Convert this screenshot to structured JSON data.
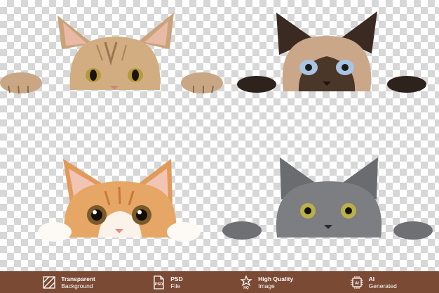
{
  "footer": {
    "background_color": "#7a4a34",
    "features": [
      {
        "icon": "transparent-background-icon",
        "line1": "Transparent",
        "line2": "Background"
      },
      {
        "icon": "psd-file-icon",
        "line1": "PSD",
        "line2": "File"
      },
      {
        "icon": "high-quality-image-icon",
        "line1": "High Quality",
        "line2": "Image"
      },
      {
        "icon": "ai-generated-icon",
        "line1": "AI",
        "line2": "Generated"
      }
    ]
  },
  "image": {
    "background": "transparency-checkerboard",
    "subjects": [
      "tabby-cat",
      "siamese-cat",
      "orange-white-kitten",
      "gray-cat"
    ]
  }
}
